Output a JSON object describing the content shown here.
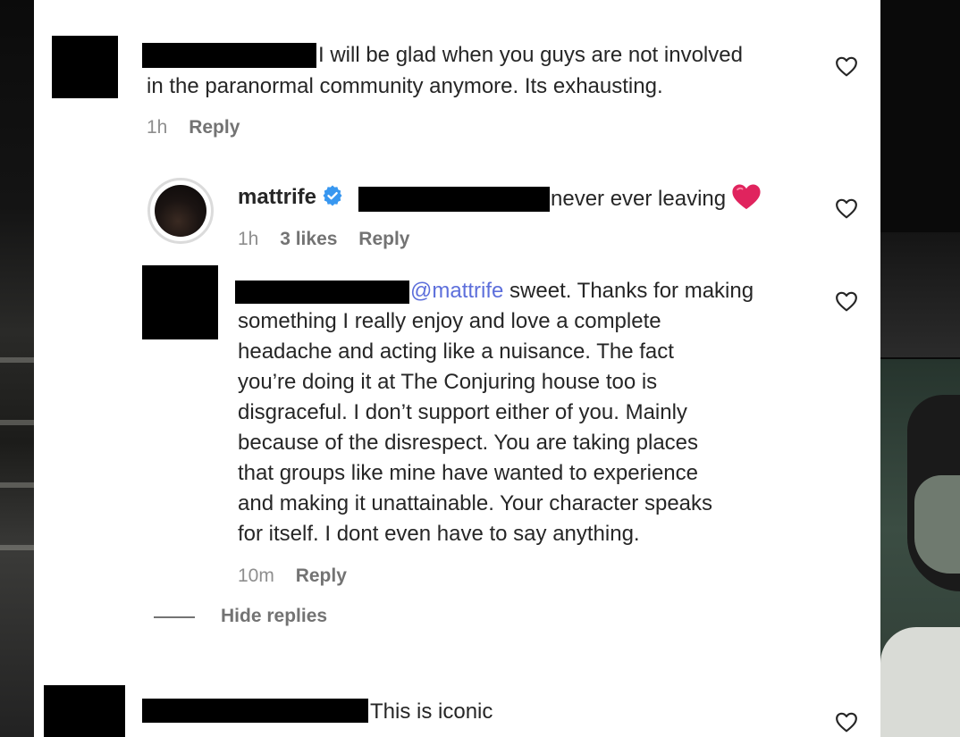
{
  "comments": [
    {
      "id": "c1",
      "text_line1": "I will be glad when you guys are not involved",
      "text_line2": "in the paranormal community anymore. Its exhausting.",
      "time": "1h",
      "reply_label": "Reply"
    },
    {
      "id": "c2",
      "username": "mattrife",
      "verified": true,
      "text": "never ever leaving",
      "time": "1h",
      "likes": "3 likes",
      "reply_label": "Reply"
    },
    {
      "id": "c3",
      "mention": "@mattrife",
      "lines": [
        " sweet. Thanks for making",
        "something I really enjoy and love a complete",
        "headache and acting like a nuisance. The fact",
        "you’re doing it at The Conjuring house too is",
        "disgraceful. I don’t support either of you. Mainly",
        "because of the disrespect. You are taking places",
        "that groups like mine have wanted to experience",
        "and making it unattainable. Your character speaks",
        "for itself. I dont even have to say anything."
      ],
      "time": "10m",
      "reply_label": "Reply"
    },
    {
      "id": "c4",
      "text": "This is iconic"
    }
  ],
  "hide_replies_label": "Hide replies",
  "colors": {
    "mention": "#5d6fdb",
    "verified": "#3897f0",
    "heart_emoji": "#e0245e"
  },
  "icons": {
    "like": "heart-outline-icon",
    "verified": "verified-badge-icon",
    "emoji": "red-heart-emoji"
  }
}
